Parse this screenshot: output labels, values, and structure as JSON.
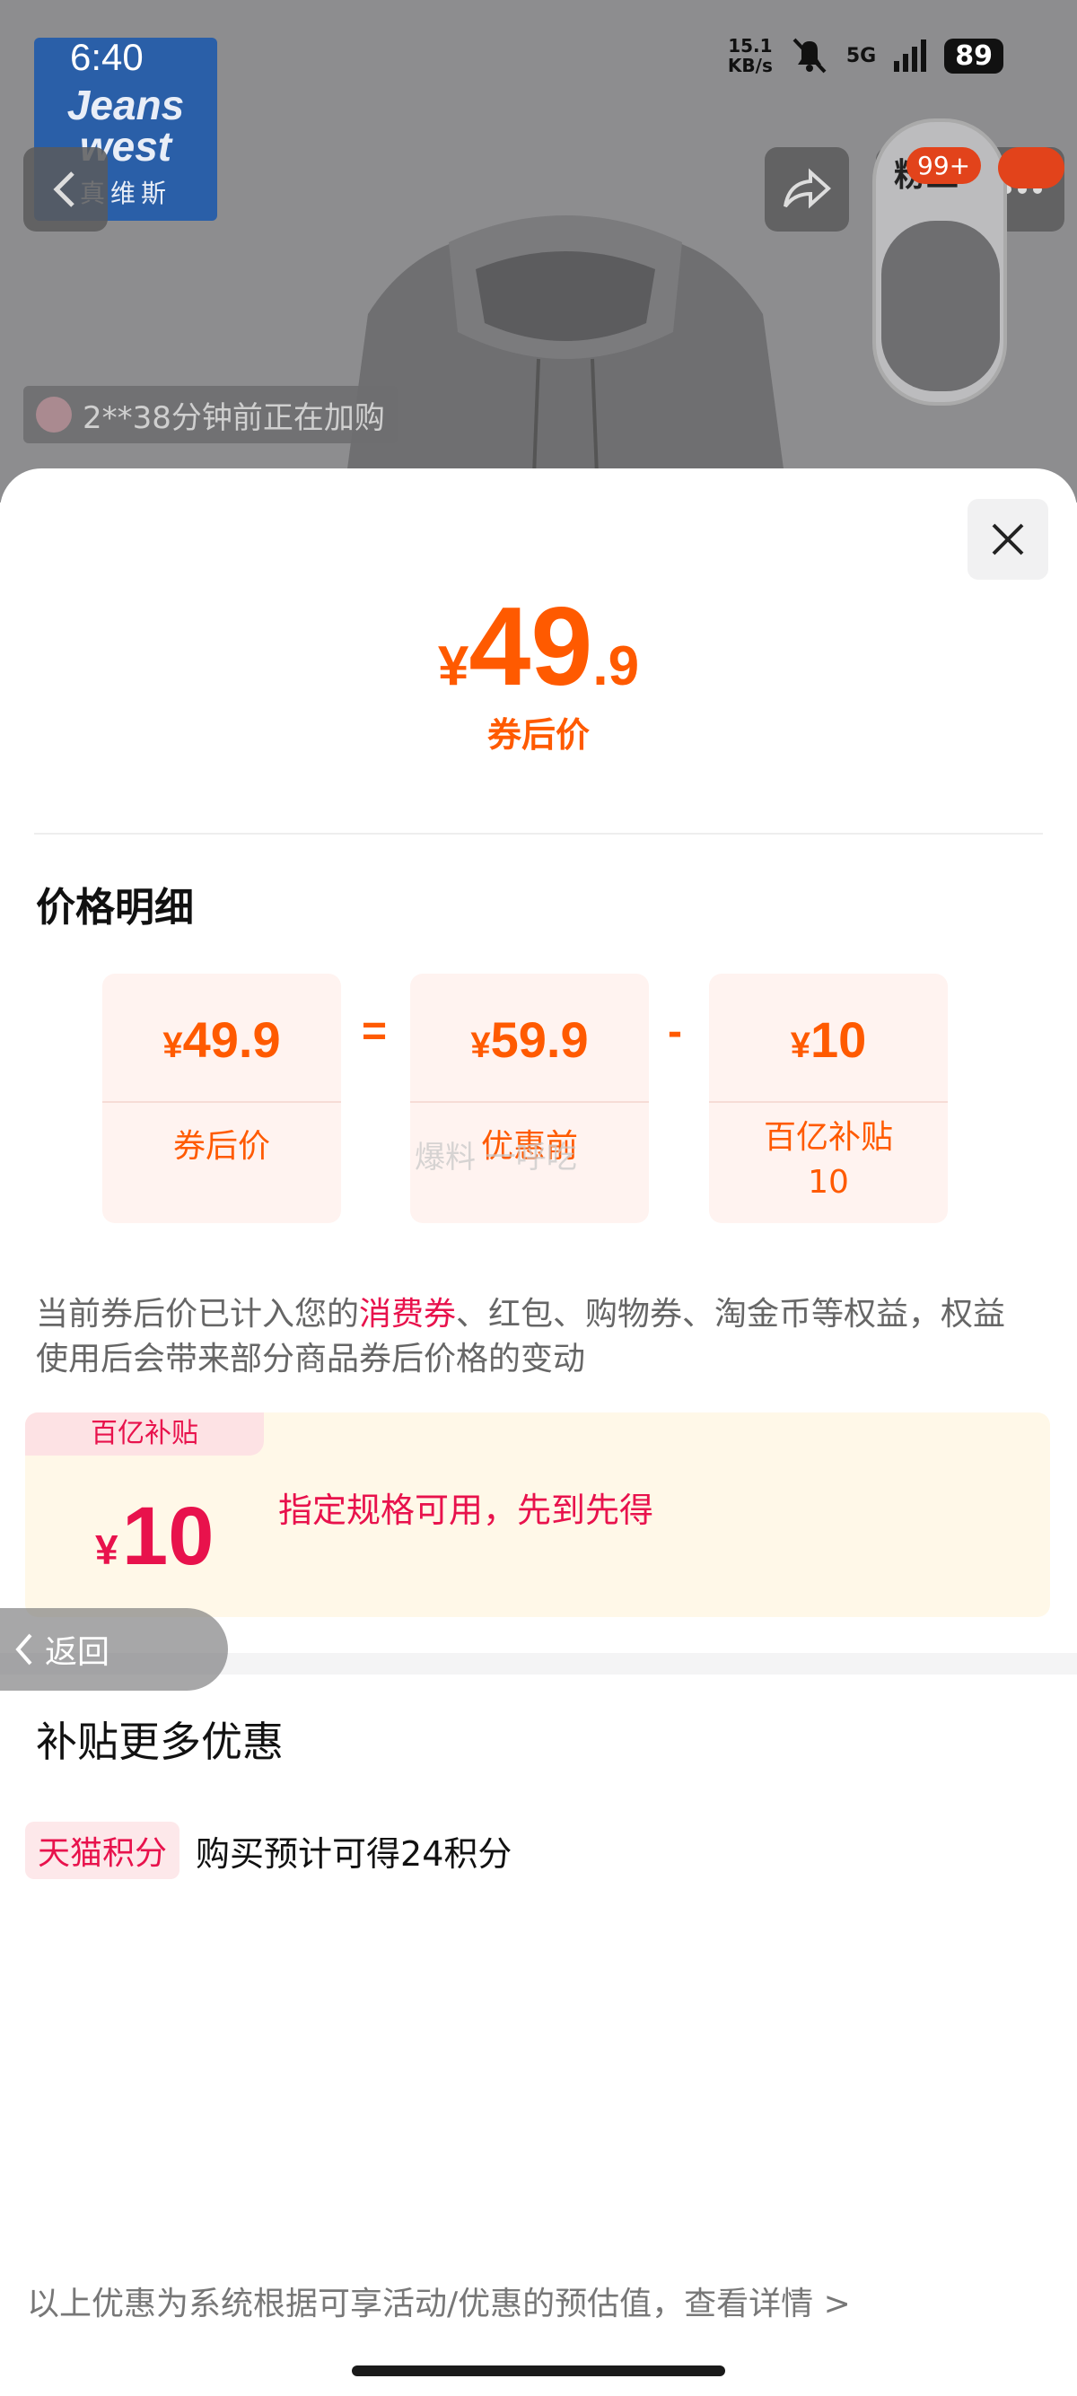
{
  "status_bar": {
    "time": "6:40",
    "net_speed_value": "15.1",
    "net_speed_unit": "KB/s",
    "network": "5G",
    "battery": "89"
  },
  "background": {
    "brand_logo_line1": "Jeans",
    "brand_logo_line2": "west",
    "brand_logo_line3": "真维斯",
    "cart_badge": "99+",
    "side_card_text": "粉丝",
    "buyer_notice": "2**38分钟前正在加购"
  },
  "sheet": {
    "price_currency": "¥",
    "price_integer": "49",
    "price_decimal": ".9",
    "price_caption": "券后价",
    "detail_title": "价格明细",
    "breakdown": [
      {
        "currency": "¥",
        "value": "49.9",
        "label": "券后价"
      },
      {
        "currency": "¥",
        "value": "59.9",
        "label": "优惠前"
      },
      {
        "currency": "¥",
        "value": "10",
        "label": "百亿补贴\n10"
      }
    ],
    "op_equals": "=",
    "op_minus": "-",
    "watermark": "爆料  一呼吃",
    "note_before": "当前券后价已计入您的",
    "note_highlight": "消费券",
    "note_after": "、红包、购物券、淘金币等权益，权益使用后会带来部分商品券后价格的变动",
    "coupon": {
      "tag": "百亿补贴",
      "currency": "¥",
      "amount": "10",
      "desc": "指定规格可用，先到先得"
    },
    "back_label": "返回",
    "more_title": "补贴更多优惠",
    "tmall_tag": "天猫积分",
    "tmall_text": "购买预计可得24积分",
    "footer": "以上优惠为系统根据可享活动/优惠的预估值，查看详情 >"
  },
  "colors": {
    "accent_orange": "#ff5a00",
    "accent_red": "#e8124c",
    "card_bg": "#fff3f0",
    "coupon_bg": "#fff8e8"
  }
}
